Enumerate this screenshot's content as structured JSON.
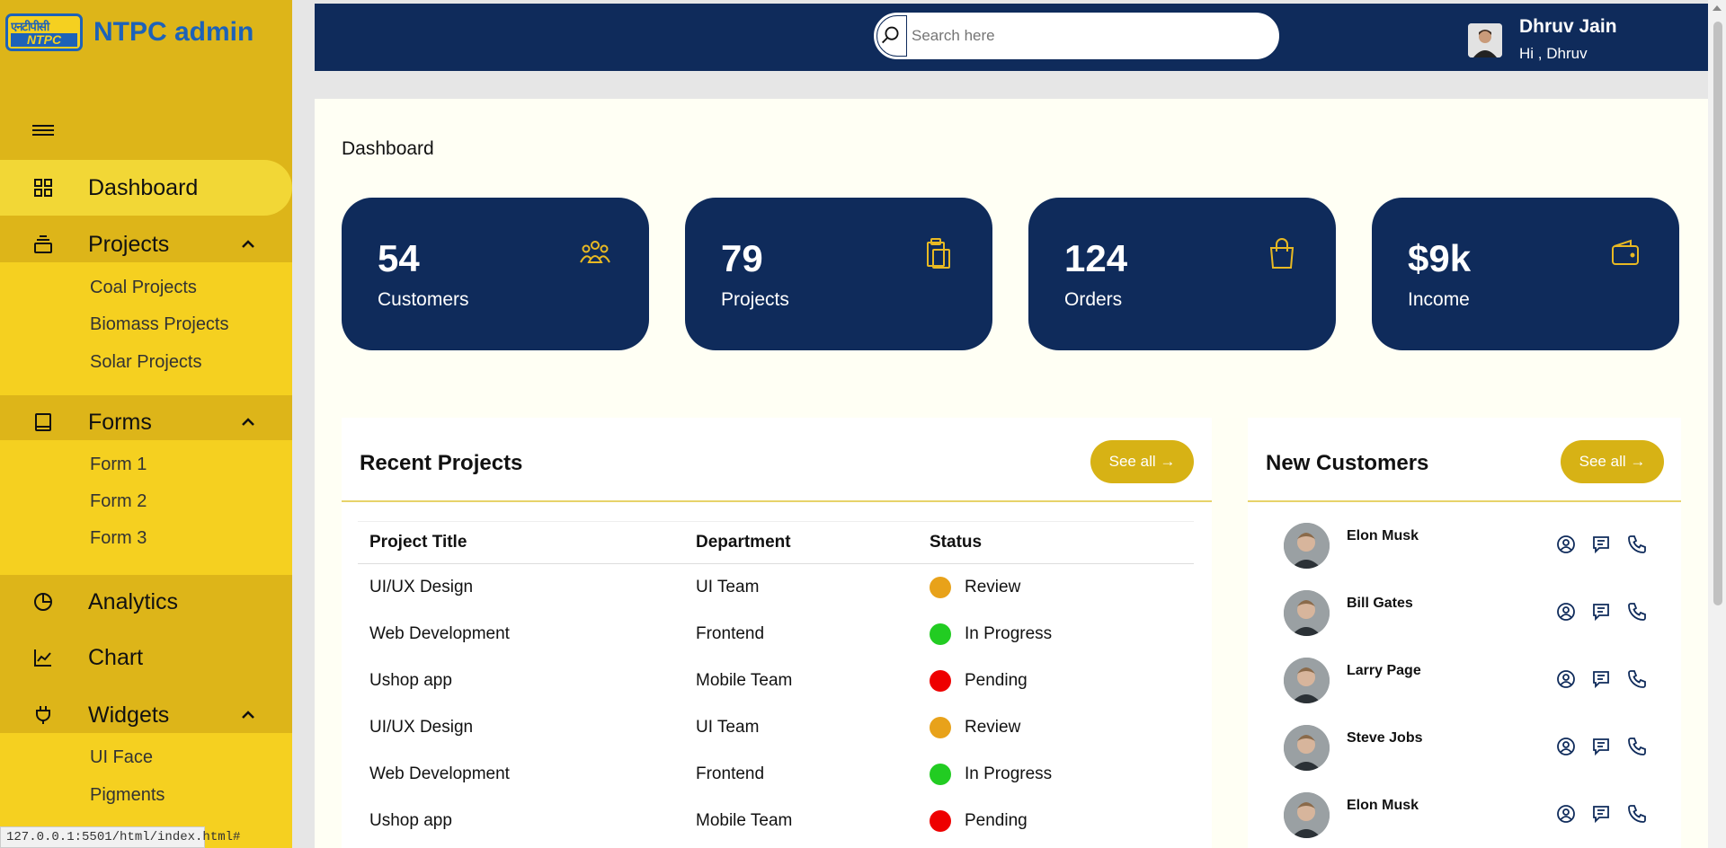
{
  "brand": {
    "logo_hindi": "एनटीपीसी",
    "logo_text": "NTPC",
    "title": "NTPC admin"
  },
  "sidebar": {
    "items": [
      {
        "label": "Dashboard",
        "icon": "grid-icon"
      },
      {
        "label": "Projects",
        "icon": "layers-icon"
      },
      {
        "label": "Forms",
        "icon": "book-icon"
      },
      {
        "label": "Analytics",
        "icon": "pie-chart-icon"
      },
      {
        "label": "Chart",
        "icon": "line-chart-icon"
      },
      {
        "label": "Widgets",
        "icon": "plug-icon"
      }
    ],
    "projects_sub": [
      "Coal Projects",
      "Biomass Projects",
      "Solar Projects"
    ],
    "forms_sub": [
      "Form 1",
      "Form 2",
      "Form 3"
    ],
    "widgets_sub": [
      "UI Face",
      "Pigments"
    ]
  },
  "search": {
    "placeholder": "Search here"
  },
  "user": {
    "name": "Dhruv Jain",
    "greeting": "Hi , Dhruv"
  },
  "page_title": "Dashboard",
  "cards": [
    {
      "value": "54",
      "label": "Customers",
      "icon": "users-icon"
    },
    {
      "value": "79",
      "label": "Projects",
      "icon": "clipboard-icon"
    },
    {
      "value": "124",
      "label": "Orders",
      "icon": "shopping-bag-icon"
    },
    {
      "value": "$9k",
      "label": "Income",
      "icon": "wallet-icon"
    }
  ],
  "recent_projects": {
    "title": "Recent Projects",
    "see_all": "See all →",
    "headers": [
      "Project Title",
      "Department",
      "Status"
    ],
    "rows": [
      {
        "title": "UI/UX Design",
        "dept": "UI Team",
        "status": "Review",
        "color": "#e8a21a"
      },
      {
        "title": "Web Development",
        "dept": "Frontend",
        "status": "In Progress",
        "color": "#22cc22"
      },
      {
        "title": "Ushop app",
        "dept": "Mobile Team",
        "status": "Pending",
        "color": "#ee0000"
      },
      {
        "title": "UI/UX Design",
        "dept": "UI Team",
        "status": "Review",
        "color": "#e8a21a"
      },
      {
        "title": "Web Development",
        "dept": "Frontend",
        "status": "In Progress",
        "color": "#22cc22"
      },
      {
        "title": "Ushop app",
        "dept": "Mobile Team",
        "status": "Pending",
        "color": "#ee0000"
      }
    ]
  },
  "new_customers": {
    "title": "New Customers",
    "see_all": "See all →",
    "list": [
      "Elon Musk",
      "Bill Gates",
      "Larry Page",
      "Steve Jobs",
      "Elon Musk"
    ]
  },
  "status_url": "127.0.0.1:5501/html/index.html#",
  "colors": {
    "sidebar": "#ddb519",
    "submenu": "#f5d020",
    "navy": "#0f2b5b",
    "accent": "#d7b215"
  }
}
